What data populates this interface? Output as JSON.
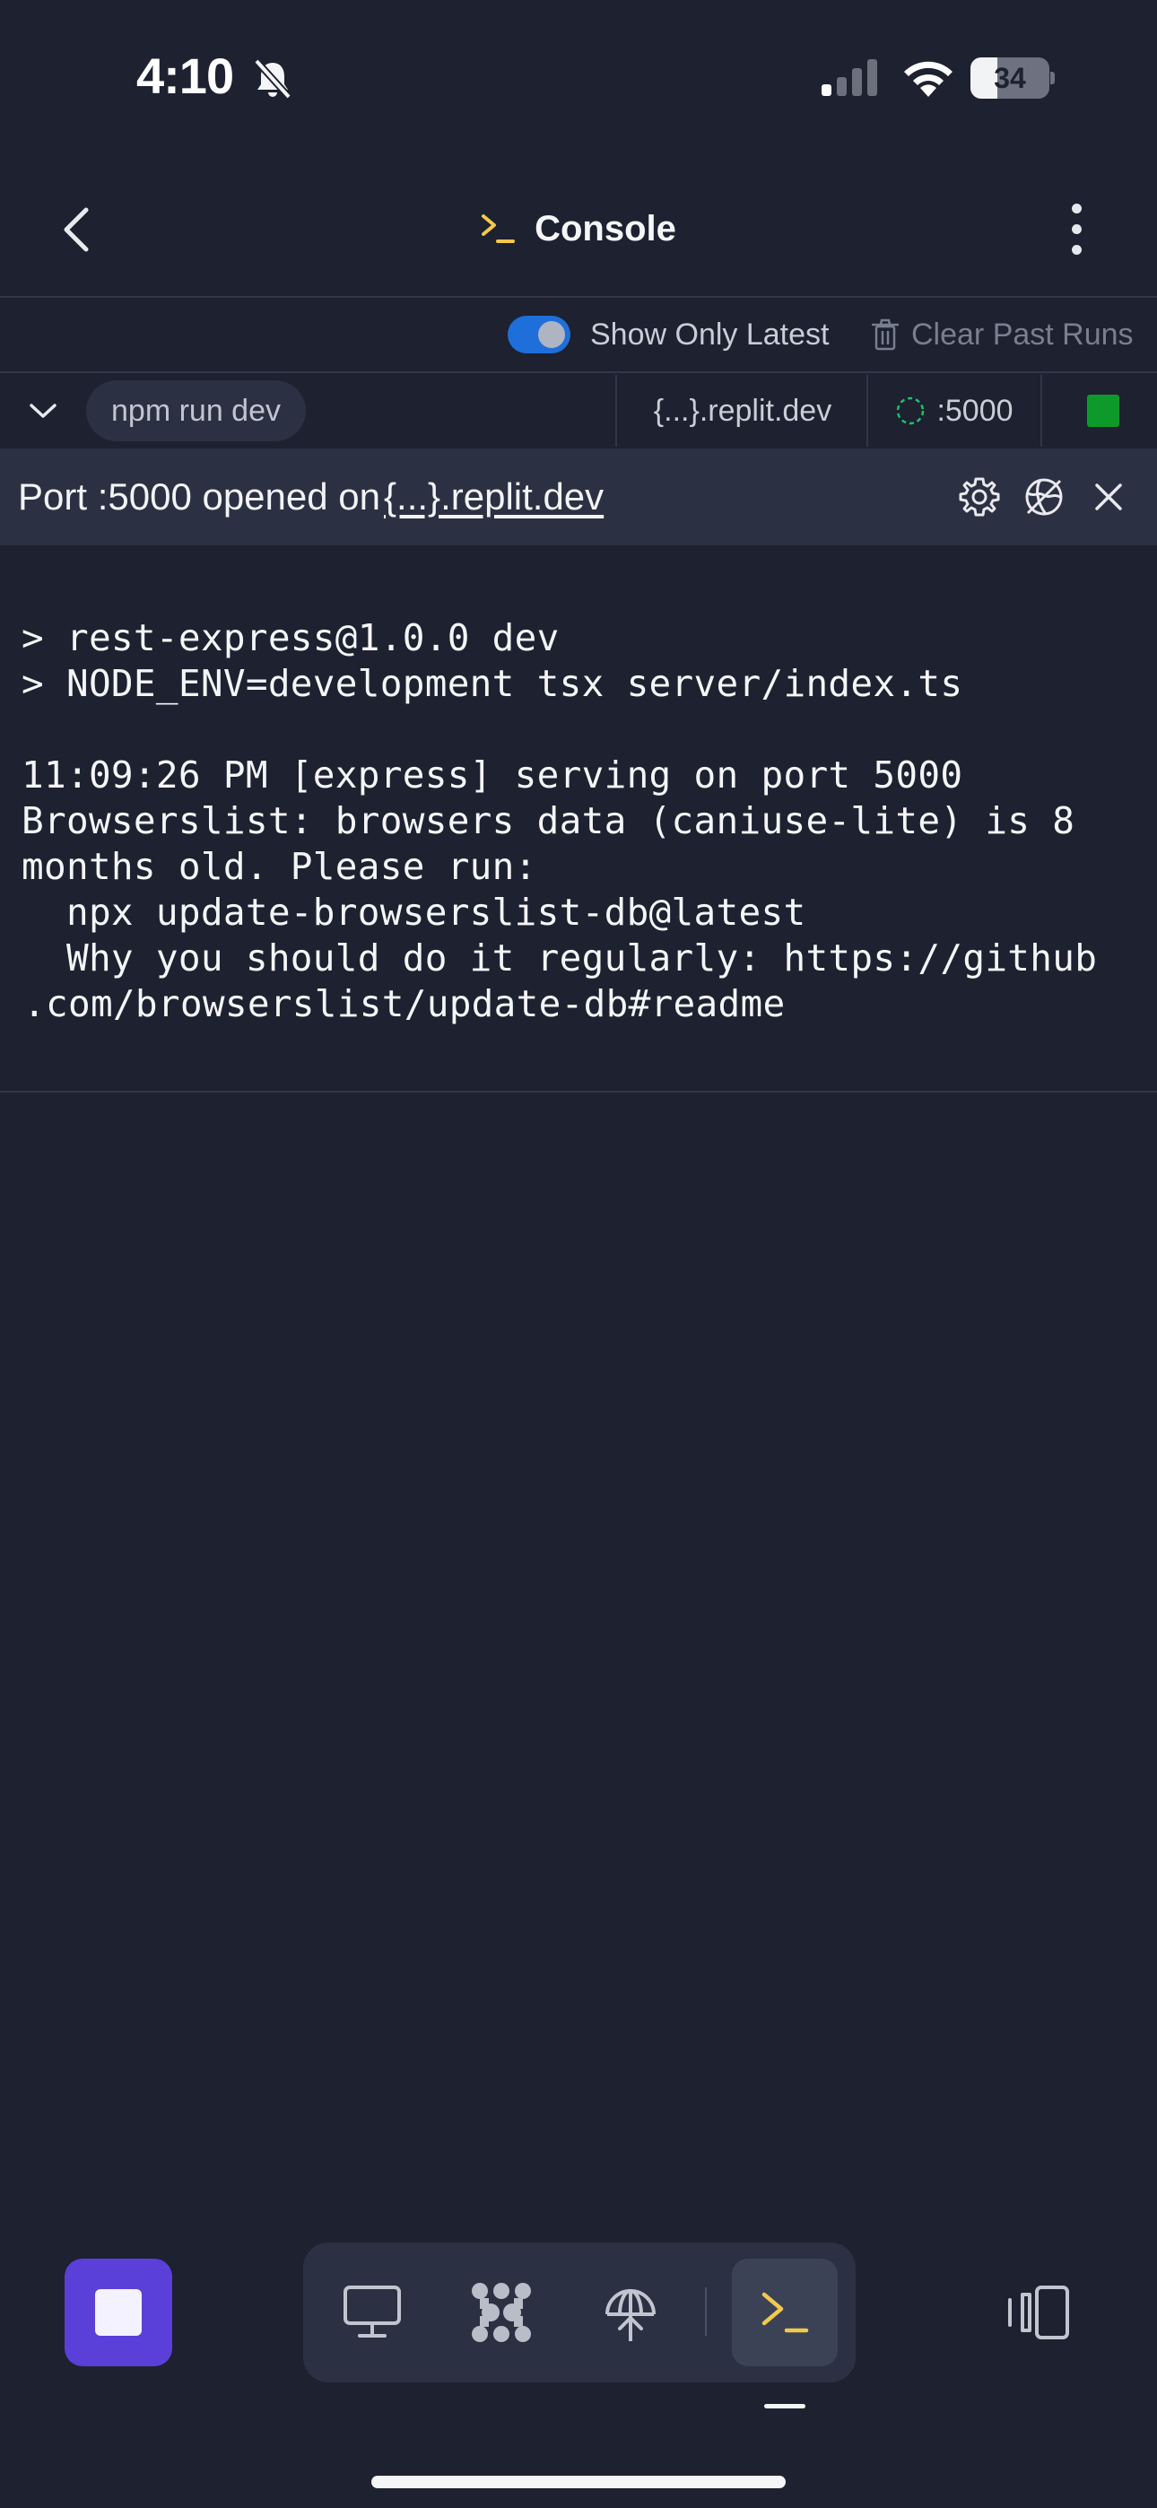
{
  "status_bar": {
    "time": "4:10",
    "battery_percent": 34,
    "battery_label": "34"
  },
  "header": {
    "title": "Console",
    "title_icon": "terminal-prompt-icon",
    "back_icon": "chevron-left-icon",
    "menu_icon": "more-vertical-icon"
  },
  "toolbar": {
    "show_only_latest_label": "Show Only Latest",
    "show_only_latest_on": true,
    "clear_label": "Clear Past Runs"
  },
  "run_tabs": {
    "command": "npm run dev",
    "url": "{...}.replit.dev",
    "port": ":5000",
    "status_color": "#0e9a2a"
  },
  "port_banner": {
    "prefix": "Port :5000 opened on",
    "link": "{...}.replit.dev"
  },
  "console": {
    "lines": [
      "> rest-express@1.0.0 dev",
      "> NODE_ENV=development tsx server/index.ts",
      "",
      "11:09:26 PM [express] serving on port 5000",
      "Browserslist: browsers data (caniuse-lite) is 8",
      "months old. Please run:",
      "  npx update-browserslist-db@latest",
      "  Why you should do it regularly: https://github",
      ".com/browserslist/update-db#readme"
    ]
  },
  "bottom_bar": {
    "tools": [
      "webview-icon",
      "extensions-icon",
      "deployments-icon",
      "console-icon"
    ],
    "active_tool": "console-icon"
  },
  "colors": {
    "background": "#1d2130",
    "panel": "#2b3142",
    "accent_toggle": "#1e6fd9",
    "stop_button": "#5b3fd9",
    "prompt_yellow": "#f2c94c"
  }
}
